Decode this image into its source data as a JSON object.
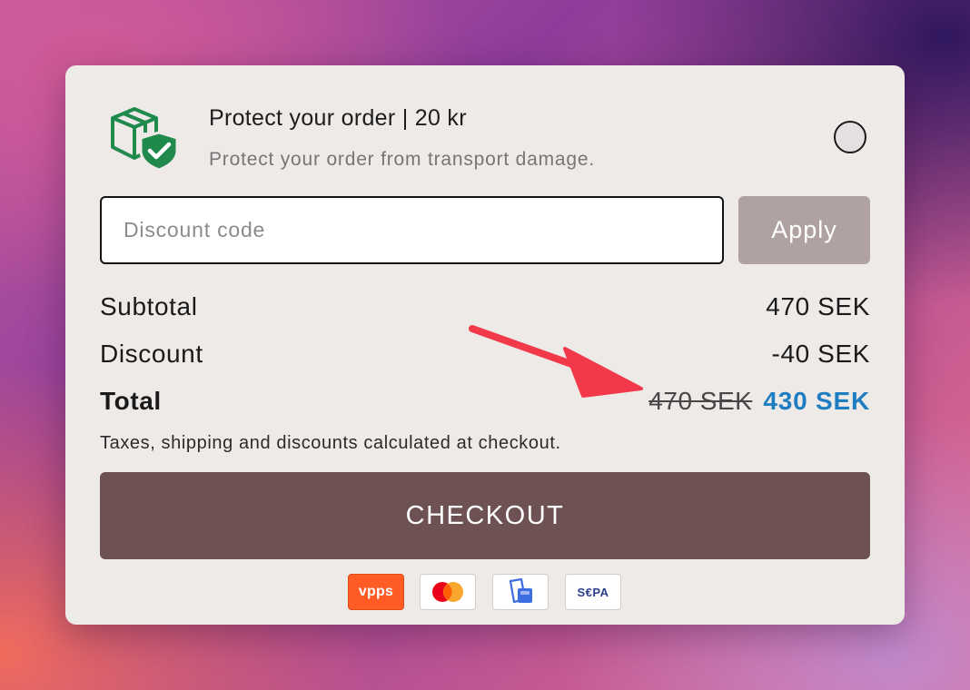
{
  "protection": {
    "title": "Protect your order | 20 kr",
    "subtitle": "Protect your order from transport damage.",
    "icon": "shield-box-icon",
    "selected": false
  },
  "discount": {
    "placeholder": "Discount code",
    "value": "",
    "apply_label": "Apply"
  },
  "summary": {
    "subtotal_label": "Subtotal",
    "subtotal_value": "470 SEK",
    "discount_label": "Discount",
    "discount_value": "-40 SEK",
    "total_label": "Total",
    "total_original": "470 SEK",
    "total_final": "430 SEK",
    "note": "Taxes, shipping and discounts calculated at checkout."
  },
  "checkout": {
    "label": "CHECKOUT"
  },
  "payment_methods": [
    {
      "name": "vipps-icon",
      "text": "vpps"
    },
    {
      "name": "mastercard-icon",
      "text": ""
    },
    {
      "name": "wallet-icon",
      "text": ""
    },
    {
      "name": "sepa-icon",
      "text": "S€PA"
    }
  ],
  "colors": {
    "accent_blue": "#1f7ec2",
    "checkout_bg": "#6e5253",
    "apply_bg": "#b0a2a3",
    "shield_green": "#1f8a4c",
    "annotation_red": "#f2394a"
  }
}
